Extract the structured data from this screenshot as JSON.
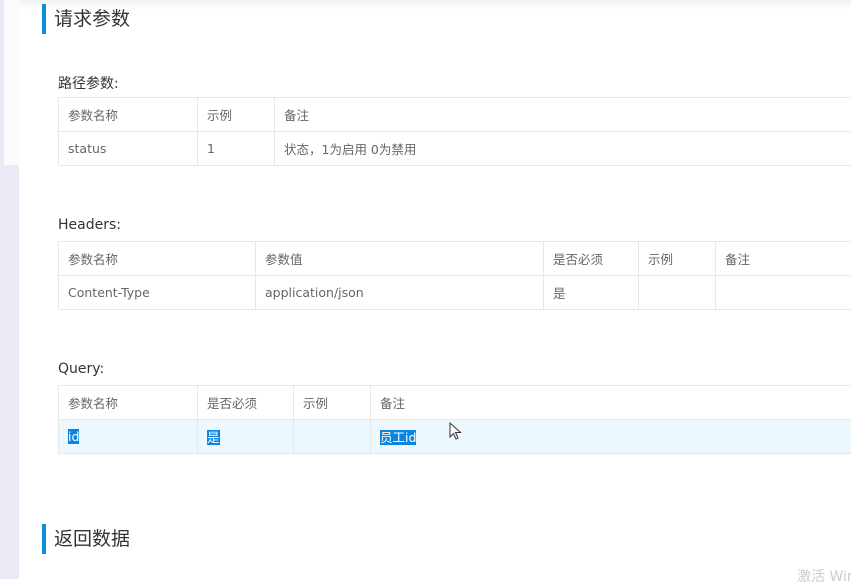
{
  "sections": {
    "request": "请求参数",
    "response": "返回数据"
  },
  "path_params": {
    "label": "路径参数:",
    "headers": [
      "参数名称",
      "示例",
      "备注"
    ],
    "rows": [
      [
        "status",
        "1",
        "状态，1为启用 0为禁用"
      ]
    ]
  },
  "headers": {
    "label": "Headers:",
    "headers": [
      "参数名称",
      "参数值",
      "是否必须",
      "示例",
      "备注"
    ],
    "rows": [
      [
        "Content-Type",
        "application/json",
        "是",
        "",
        ""
      ]
    ]
  },
  "query": {
    "label": "Query:",
    "headers": [
      "参数名称",
      "是否必须",
      "示例",
      "备注"
    ],
    "rows": [
      [
        "id",
        "是",
        "",
        "员工id"
      ]
    ]
  },
  "watermark": "激活 Windows",
  "colors": {
    "accent": "#0a8fd8",
    "selection": "#0a84e0",
    "row_highlight": "#ecf8fe"
  }
}
